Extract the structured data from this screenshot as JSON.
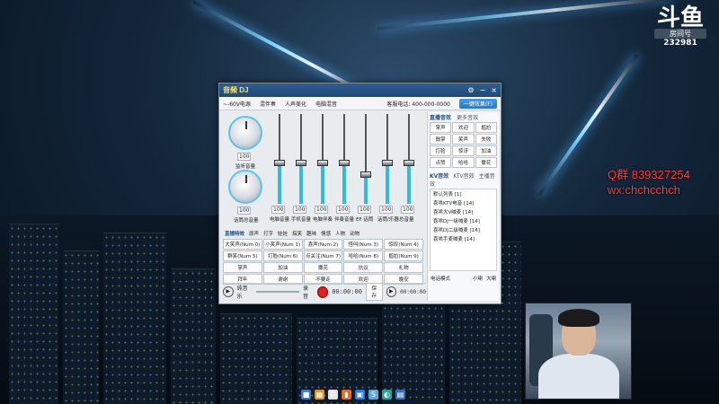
{
  "stream": {
    "qq_group": "Q群 839327254",
    "wechat": "wx:chchcchch",
    "logo_brand": "斗鱼",
    "room_label": "房间号",
    "room_number": "232981"
  },
  "app": {
    "title": "音频 DJ",
    "menu": "⚙",
    "minimize": "−",
    "close": "×",
    "topbar": {
      "items": [
        "~-60V电源",
        "混伴奏",
        "人声美化",
        "电脑混音"
      ],
      "hint": "客服电话: 400-000-0000",
      "action": "一键效果(F)"
    },
    "knobs": [
      {
        "label": "监听音量",
        "value": "100"
      },
      {
        "label": "话筒总音量",
        "value": "100"
      }
    ],
    "channels": [
      {
        "label": "电脑音量",
        "value": "100",
        "level": 0.45
      },
      {
        "label": "手机音量",
        "value": "100",
        "level": 0.45
      },
      {
        "label": "电脑伴奏",
        "value": "100",
        "level": 0.45
      },
      {
        "label": "伴奏音量",
        "value": "100",
        "level": 0.45
      },
      {
        "label": "EF 话筒",
        "value": "100",
        "level": 0.3
      },
      {
        "label": "话筒/乐器",
        "value": "100",
        "level": 0.45
      }
    ],
    "master": {
      "label": "总音量",
      "value": "100"
    },
    "right_panel": {
      "title": "直播音效",
      "subtitle": "更多音效",
      "buttons": [
        "掌声",
        "欢迎",
        "尴尬",
        "鼓掌",
        "笑声",
        "失败",
        "打脸",
        "惊讶",
        "加油",
        "点赞",
        "哈哈",
        "撒花"
      ],
      "kv_title": "KV音效",
      "kv_tab": "KTV音效",
      "kv_tab2": "主播音效",
      "list": [
        "默认列表 [1]",
        "喜哄KTV电音 [14]",
        "喜哄大V喊麦 [14]",
        "喜哄DJ一级喊麦 [14]",
        "喜哄DJ二级喊麦 [14]",
        "喜哄手麦喊麦 [14]"
      ],
      "footer_hint": "电话模式",
      "footer_a": "小喇",
      "footer_b": "大喇"
    },
    "effects": {
      "title": "直播特效",
      "tabs": [
        "原声",
        "打字",
        "娃娃",
        "搞笑",
        "趣味",
        "情感",
        "人物",
        "动物"
      ],
      "buttons": [
        "大笑声(Num 0)",
        "小笑声(Num 1)",
        "喜声(Num 2)",
        "怪叫(Num 3)",
        "惊叹(Num 4)",
        "群笑(Num 5)",
        "打脸(Num 6)",
        "点关注(Num 7)",
        "哈哈(Num 8)",
        "尴尬(Num 9)",
        "掌声",
        "加油",
        "撒花",
        "抗议",
        "礼物",
        "拜年",
        "谢谢",
        "不要走",
        "欢迎",
        "晚安"
      ]
    },
    "player": {
      "now_playing": "纯音乐",
      "rec_label": "录音",
      "time": "00:00:00",
      "save": "保存",
      "time2": "00:00:00"
    }
  },
  "taskbar": [
    "■",
    "▦",
    "G",
    "▮",
    "▣",
    "S",
    "◐",
    "▤"
  ]
}
